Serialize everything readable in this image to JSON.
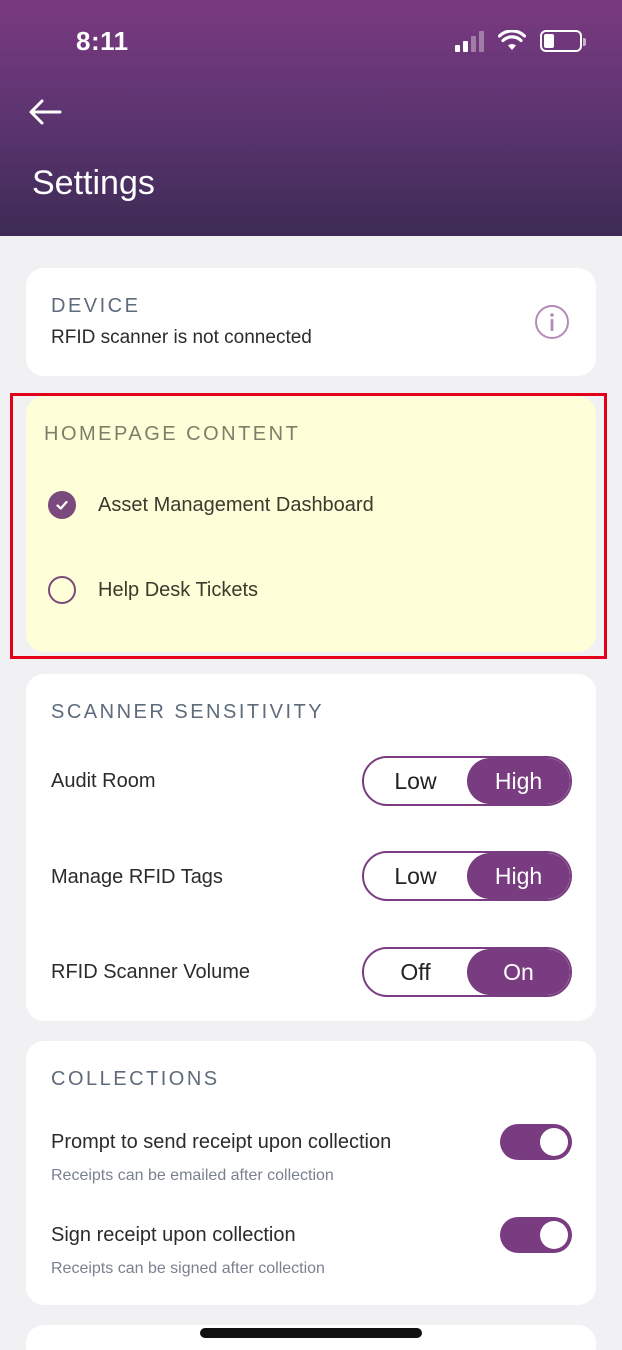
{
  "status_bar": {
    "time": "8:11"
  },
  "header": {
    "title": "Settings"
  },
  "device": {
    "label": "DEVICE",
    "status": "RFID scanner is not connected"
  },
  "homepage": {
    "label": "HOMEPAGE CONTENT",
    "options": [
      {
        "label": "Asset Management Dashboard",
        "checked": true
      },
      {
        "label": "Help Desk Tickets",
        "checked": false
      }
    ]
  },
  "scanner": {
    "label": "SCANNER SENSITIVITY",
    "rows": [
      {
        "label": "Audit Room",
        "off": "Low",
        "on": "High",
        "selected": "High"
      },
      {
        "label": "Manage RFID Tags",
        "off": "Low",
        "on": "High",
        "selected": "High"
      },
      {
        "label": "RFID Scanner Volume",
        "off": "Off",
        "on": "On",
        "selected": "On"
      }
    ]
  },
  "collections": {
    "label": "COLLECTIONS",
    "items": [
      {
        "title": "Prompt to send receipt upon collection",
        "subtitle": "Receipts can be emailed after collection",
        "enabled": true
      },
      {
        "title": "Sign receipt upon collection",
        "subtitle": "Receipts can be signed after collection",
        "enabled": true
      }
    ]
  },
  "colors": {
    "accent": "#7a3c80",
    "highlight_border": "#e3001b",
    "highlight_fill": "#fefed8"
  }
}
